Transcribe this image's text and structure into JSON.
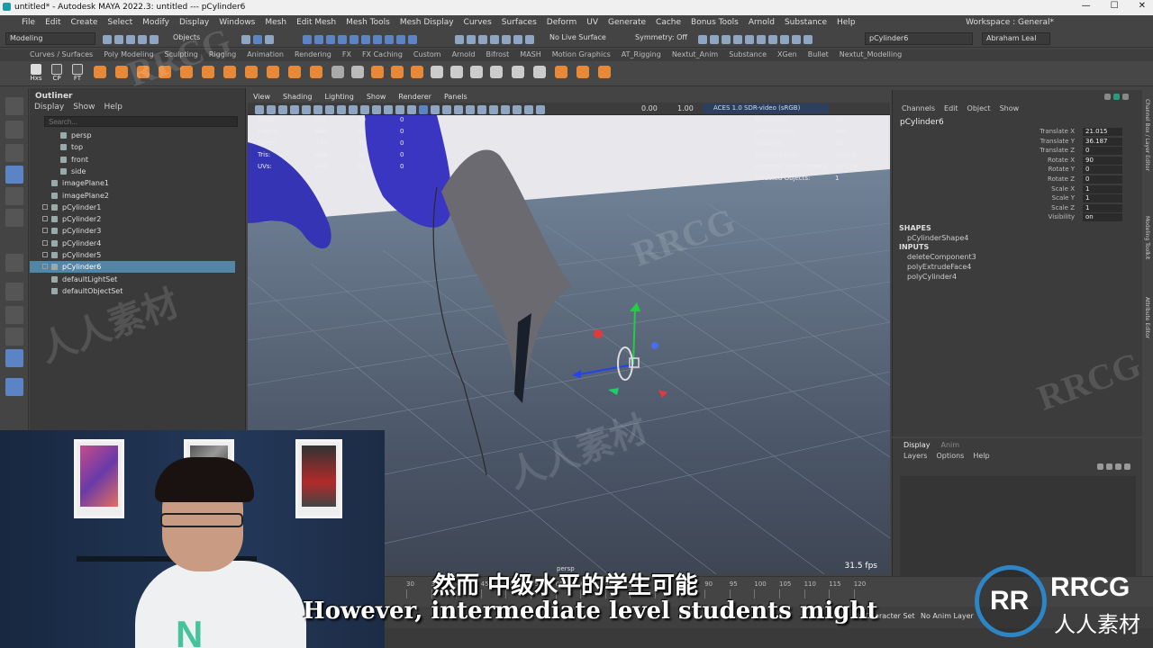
{
  "window": {
    "title": "untitled* - Autodesk MAYA 2022.3: untitled   ---   pCylinder6",
    "controls": [
      "—",
      "☐",
      "✕"
    ]
  },
  "menubar": {
    "items": [
      "File",
      "Edit",
      "Create",
      "Select",
      "Modify",
      "Display",
      "Windows",
      "Mesh",
      "Edit Mesh",
      "Mesh Tools",
      "Mesh Display",
      "Curves",
      "Surfaces",
      "Deform",
      "UV",
      "Generate",
      "Cache",
      "Bonus Tools",
      "Arnold",
      "Substance",
      "Help"
    ],
    "workspace": "Workspace : General*"
  },
  "statusline": {
    "mode": "Modeling",
    "objects": "Objects",
    "live_surface": "No Live Surface",
    "symmetry": "Symmetry: Off",
    "object_field": "pCylinder6",
    "user": "Abraham Leal"
  },
  "shelf": {
    "tabs": [
      "Curves / Surfaces",
      "Poly Modeling",
      "Sculpting",
      "Rigging",
      "Animation",
      "Rendering",
      "FX",
      "FX Caching",
      "Custom",
      "Arnold",
      "Bifrost",
      "MASH",
      "Motion Graphics",
      "AT_Rigging",
      "Nextut_Anim",
      "Substance",
      "XGen",
      "Bullet",
      "Nextut_Modelling"
    ],
    "labels": [
      "Hxs",
      "CP",
      "FT"
    ]
  },
  "outliner": {
    "title": "Outliner",
    "menu": [
      "Display",
      "Show",
      "Help"
    ],
    "search_placeholder": "Search...",
    "items": [
      {
        "label": "persp",
        "sub": true
      },
      {
        "label": "top",
        "sub": true
      },
      {
        "label": "front",
        "sub": true
      },
      {
        "label": "side",
        "sub": true
      },
      {
        "label": "imagePlane1",
        "sub": false
      },
      {
        "label": "imagePlane2",
        "sub": false
      },
      {
        "label": "pCylinder1",
        "sub": false
      },
      {
        "label": "pCylinder2",
        "sub": false
      },
      {
        "label": "pCylinder3",
        "sub": false
      },
      {
        "label": "pCylinder4",
        "sub": false
      },
      {
        "label": "pCylinder5",
        "sub": false
      },
      {
        "label": "pCylinder6",
        "sub": false,
        "selected": true
      },
      {
        "label": "defaultLightSet",
        "sub": false
      },
      {
        "label": "defaultObjectSet",
        "sub": false
      }
    ]
  },
  "viewport": {
    "menu": [
      "View",
      "Shading",
      "Lighting",
      "Show",
      "Renderer",
      "Panels"
    ],
    "field1": "0.00",
    "field2": "1.00",
    "colorspace": "ACES 1.0 SDR-video (sRGB)",
    "hud_left": [
      {
        "label": "Verts:",
        "v1": "352",
        "v2": "40",
        "v3": "0"
      },
      {
        "label": "Edges:",
        "v1": "684",
        "v2": "68",
        "v3": "0"
      },
      {
        "label": "Faces:",
        "v1": "244",
        "v2": "28",
        "v3": "0"
      },
      {
        "label": "Tris:",
        "v1": "488",
        "v2": "56",
        "v3": "0"
      },
      {
        "label": "UVs:",
        "v1": "644",
        "v2": "69",
        "v3": "0"
      }
    ],
    "hud_right": [
      {
        "label": "Backfaces:",
        "value": "On"
      },
      {
        "label": "Smoothness:",
        "value": "N/A"
      },
      {
        "label": "Instance:",
        "value": "No"
      },
      {
        "label": "Display Layer:",
        "value": "default"
      },
      {
        "label": "Distance From Camera:",
        "value": "51.158"
      },
      {
        "label": "Selected Objects:",
        "value": "1"
      }
    ],
    "camera": "persp",
    "fps": "31.5 fps"
  },
  "channelbox": {
    "menu": [
      "Channels",
      "Edit",
      "Object",
      "Show"
    ],
    "object": "pCylinder6",
    "attributes": [
      {
        "label": "Translate X",
        "value": "21.015"
      },
      {
        "label": "Translate Y",
        "value": "36.187"
      },
      {
        "label": "Translate Z",
        "value": "0"
      },
      {
        "label": "Rotate X",
        "value": "90"
      },
      {
        "label": "Rotate Y",
        "value": "0"
      },
      {
        "label": "Rotate Z",
        "value": "0"
      },
      {
        "label": "Scale X",
        "value": "1"
      },
      {
        "label": "Scale Y",
        "value": "1"
      },
      {
        "label": "Scale Z",
        "value": "1"
      },
      {
        "label": "Visibility",
        "value": "on"
      }
    ],
    "shapes_header": "SHAPES",
    "shape": "pCylinderShape4",
    "inputs_header": "INPUTS",
    "inputs": [
      "deleteComponent3",
      "polyExtrudeFace4",
      "polyCylinder4"
    ],
    "side_tabs": [
      "Channel Box / Layer Editor",
      "Modeling Toolkit",
      "Attribute Editor"
    ]
  },
  "layer_editor": {
    "tabs": [
      "Display",
      "Anim"
    ],
    "menu": [
      "Layers",
      "Options",
      "Help"
    ]
  },
  "timeline": {
    "ticks": [
      "30",
      "35",
      "40",
      "45",
      "50",
      "55",
      "60",
      "65",
      "70",
      "75",
      "80",
      "85",
      "90",
      "95",
      "100",
      "105",
      "110",
      "115",
      "120"
    ],
    "character_set": "No Character Set",
    "anim_layer": "No Anim Layer"
  },
  "subtitles": {
    "chinese": "然而 中级水平的学生可能",
    "english": "However, intermediate level students might"
  },
  "watermark": {
    "brand": "RRCG",
    "brand_cn": "人人素材",
    "logo_letters": "RR"
  },
  "colors": {
    "accent": "#5b84c4",
    "selection": "#5285a6",
    "mesh_blue": "#3434b4",
    "logo_blue": "#2d85c5"
  }
}
